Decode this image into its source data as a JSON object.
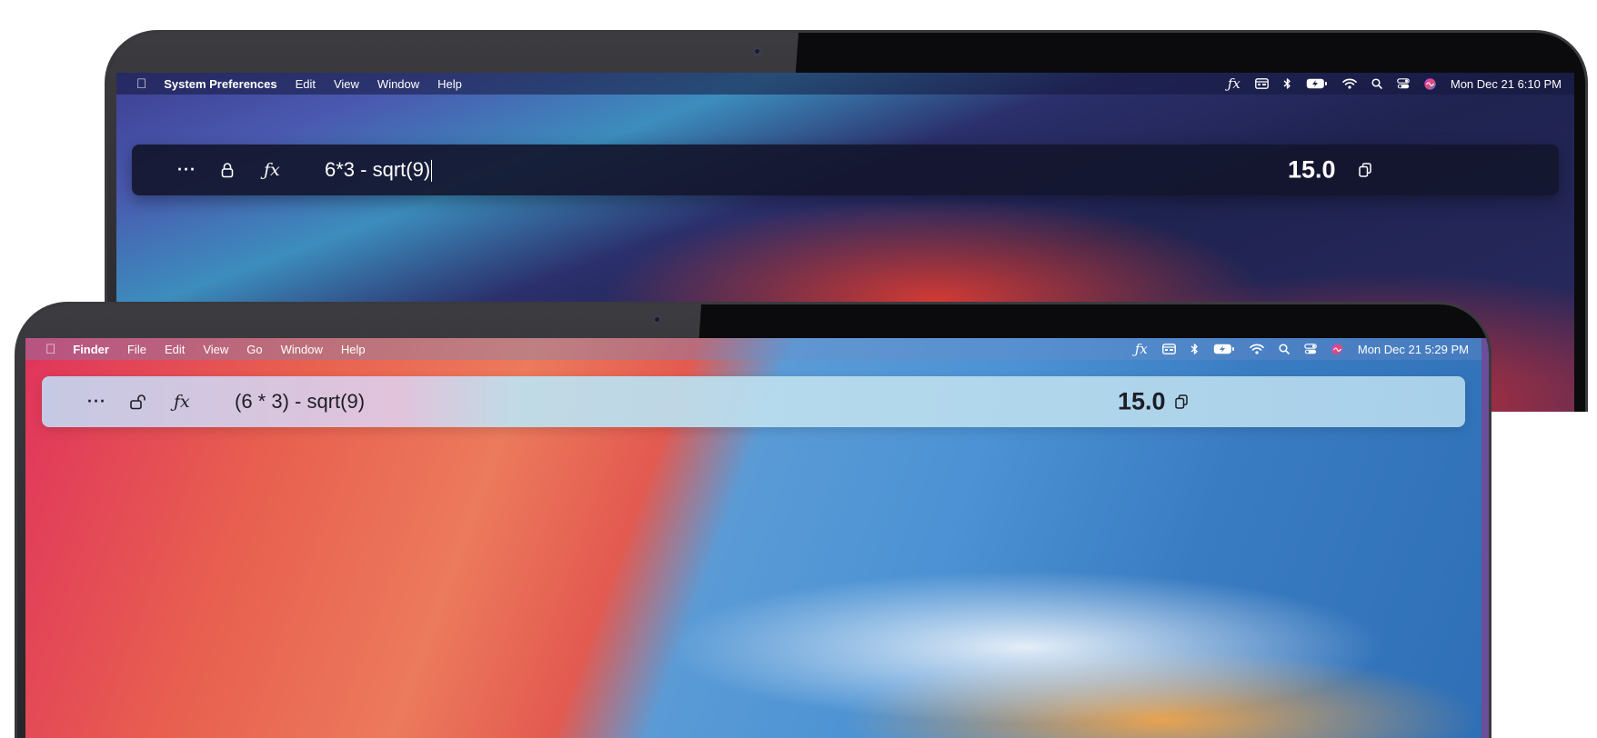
{
  "back_screen": {
    "menubar": {
      "apple_icon": "apple-logo-icon",
      "app_name": "System Preferences",
      "items": [
        "Edit",
        "View",
        "Window",
        "Help"
      ],
      "status_icons": [
        "fx-icon",
        "calendar-card-icon",
        "bluetooth-icon",
        "battery-charging-icon",
        "wifi-icon",
        "search-icon",
        "control-center-icon",
        "siri-icon"
      ],
      "clock": "Mon Dec 21  6:10 PM"
    },
    "calculator_bar": {
      "expression": "6*3 - sqrt(9)",
      "result": "15.0",
      "theme": "dark",
      "lock_state": "locked"
    }
  },
  "front_screen": {
    "menubar": {
      "apple_icon": "apple-logo-icon",
      "app_name": "Finder",
      "items": [
        "File",
        "Edit",
        "View",
        "Go",
        "Window",
        "Help"
      ],
      "status_icons": [
        "fx-icon",
        "calendar-card-icon",
        "bluetooth-icon",
        "battery-charging-icon",
        "wifi-icon",
        "search-icon",
        "control-center-icon",
        "siri-icon"
      ],
      "clock": "Mon Dec 21  5:29 PM"
    },
    "calculator_bar": {
      "expression": "(6 * 3) - sqrt(9)",
      "result": "15.0",
      "theme": "light",
      "lock_state": "unlocked"
    }
  },
  "colors": {
    "dark_bar": "#14162e",
    "light_bar": "#b0d6ec",
    "bezel": "#0b0b0d"
  }
}
